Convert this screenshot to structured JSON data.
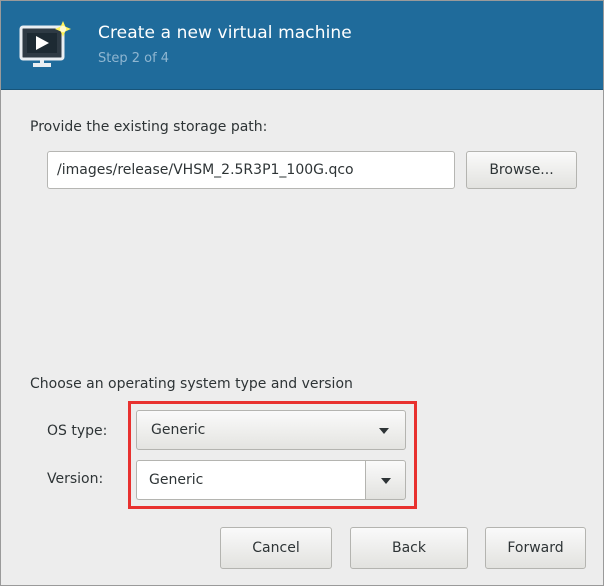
{
  "header": {
    "title": "Create a new virtual machine",
    "subtitle": "Step 2 of 4",
    "icon": "new-vm-icon"
  },
  "storage": {
    "prompt": "Provide the existing storage path:",
    "path_value": "/images/release/VHSM_2.5R3P1_100G.qco",
    "browse_label": "Browse..."
  },
  "os": {
    "section_label": "Choose an operating system type and version",
    "type_label": "OS type:",
    "type_value": "Generic",
    "version_label": "Version:",
    "version_value": "Generic"
  },
  "buttons": {
    "cancel": "Cancel",
    "back": "Back",
    "forward": "Forward"
  },
  "colors": {
    "header_bg": "#1f6b9b",
    "highlight": "#e8312f"
  }
}
